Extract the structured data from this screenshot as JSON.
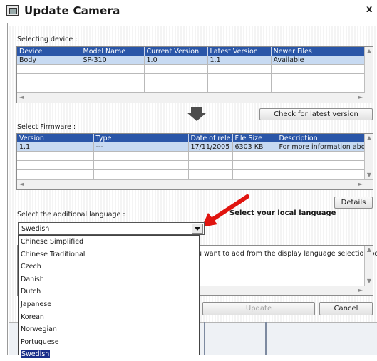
{
  "window": {
    "title": "Update Camera",
    "close_glyph": "x"
  },
  "device_section": {
    "label": "Selecting device :",
    "columns": [
      "Device",
      "Model Name",
      "Current Version",
      "Latest Version",
      "Newer Files"
    ],
    "rows": [
      [
        "Body",
        "SP-310",
        "1.0",
        "1.1",
        "Available"
      ]
    ]
  },
  "check_button": "Check for latest version",
  "firmware_section": {
    "label": "Select Firmware :",
    "columns": [
      "Version",
      "Type",
      "Date of rele..",
      "File Size",
      "Description"
    ],
    "rows": [
      [
        "1.1",
        "---",
        "17/11/2005",
        "6303 KB",
        "For more information about ..."
      ]
    ]
  },
  "details_button": "Details",
  "language": {
    "label": "Select the additional language :",
    "selected": "Swedish",
    "options": [
      "Chinese Simplified",
      "Chinese Traditional",
      "Czech",
      "Danish",
      "Dutch",
      "Japanese",
      "Korean",
      "Norwegian",
      "Portuguese",
      "Swedish"
    ],
    "hint_partial": "u want to add from the display language selection box."
  },
  "annotation": {
    "text": "Select your local language",
    "arrow_color": "#e0140f"
  },
  "footer": {
    "update_button": "Update",
    "cancel_button": "Cancel"
  },
  "colors": {
    "header_blue": "#2a56a8",
    "selected_row": "#c7daf2",
    "dropdown_highlight": "#1b2f8a"
  },
  "icons": {
    "window_icon": "camera-app-icon",
    "step_arrow": "down-arrow-icon",
    "dropdown": "chevron-down-icon"
  }
}
